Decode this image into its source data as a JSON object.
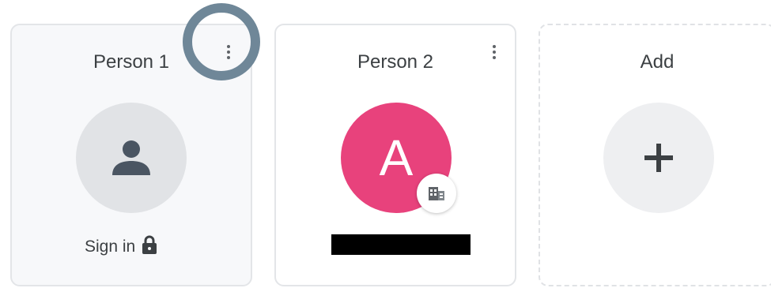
{
  "profiles": [
    {
      "name": "Person 1",
      "avatar_icon": "person-icon",
      "action_label": "Sign in",
      "action_icon": "lock-icon",
      "menu_icon": "more-vert-icon"
    },
    {
      "name": "Person 2",
      "avatar_letter": "A",
      "avatar_color": "#e8427c",
      "badge_icon": "enterprise-building-icon",
      "email_redacted": true,
      "menu_icon": "more-vert-icon"
    }
  ],
  "add_tile": {
    "label": "Add",
    "icon": "plus-icon"
  },
  "highlight": {
    "target": "profile-1-menu",
    "color": "#6f8798"
  }
}
